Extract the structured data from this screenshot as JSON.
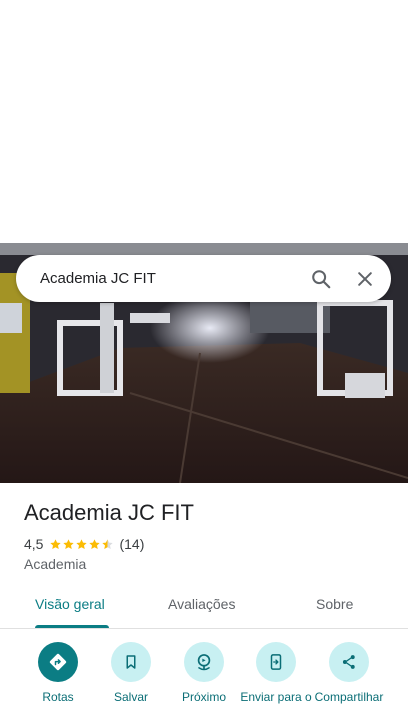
{
  "search": {
    "query": "Academia JC FIT"
  },
  "place": {
    "name": "Academia JC FIT",
    "rating": "4,5",
    "stars": 4.5,
    "review_count": "(14)",
    "category": "Academia"
  },
  "tabs": [
    {
      "label": "Visão geral",
      "active": true
    },
    {
      "label": "Avaliações",
      "active": false
    },
    {
      "label": "Sobre",
      "active": false
    }
  ],
  "actions": [
    {
      "label": "Rotas",
      "icon": "directions-icon"
    },
    {
      "label": "Salvar",
      "icon": "bookmark-icon"
    },
    {
      "label": "Próximo",
      "icon": "nearby-icon"
    },
    {
      "label": "Enviar para o",
      "icon": "send-to-phone-icon"
    },
    {
      "label": "Compartilhar",
      "icon": "share-icon"
    }
  ],
  "colors": {
    "accent": "#0b7d84",
    "action_bg": "#c8f0f2",
    "star": "#fbbc04"
  }
}
